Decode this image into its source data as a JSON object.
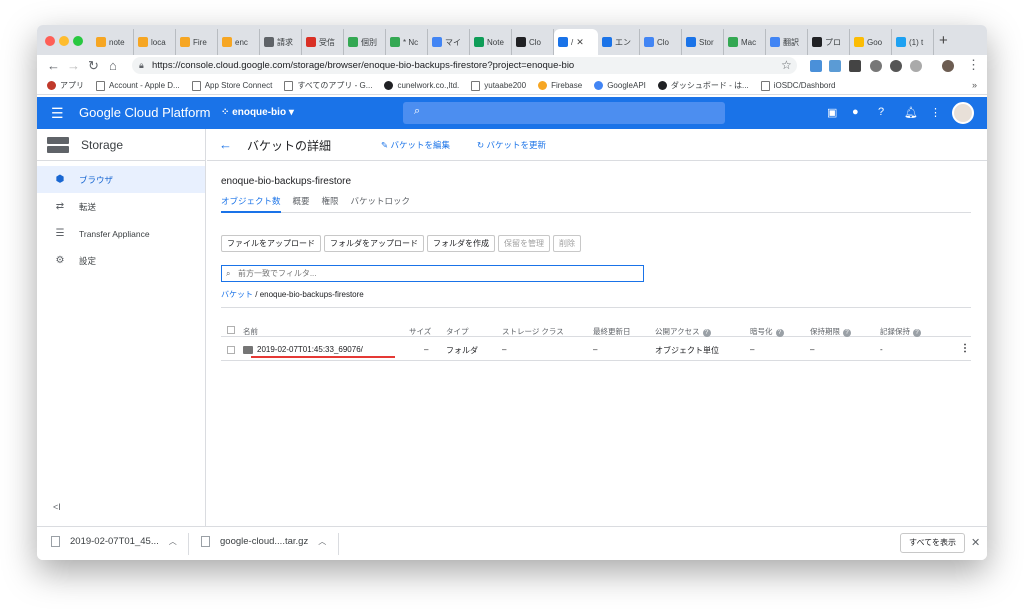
{
  "tabs": [
    {
      "label": "note",
      "color": "#f6a623"
    },
    {
      "label": "loca",
      "color": "#f6a623"
    },
    {
      "label": "Fire",
      "color": "#f6a623"
    },
    {
      "label": "enc",
      "color": "#f6a623"
    },
    {
      "label": "請求",
      "color": "#5f6368"
    },
    {
      "label": "受信",
      "color": "#d93025"
    },
    {
      "label": "個別",
      "color": "#34a853"
    },
    {
      "label": "* Nc",
      "color": "#34a853"
    },
    {
      "label": "マイ",
      "color": "#4285f4"
    },
    {
      "label": "Note",
      "color": "#0f9d58"
    },
    {
      "label": "Clo",
      "color": "#202124"
    },
    {
      "label": "/",
      "color": "#1a73e8",
      "active": true
    },
    {
      "label": "エン",
      "color": "#1a73e8"
    },
    {
      "label": "Clo",
      "color": "#4285f4"
    },
    {
      "label": "Stor",
      "color": "#1a73e8"
    },
    {
      "label": "Mac",
      "color": "#34a853"
    },
    {
      "label": "翻訳",
      "color": "#4285f4"
    },
    {
      "label": "プロ",
      "color": "#202124"
    },
    {
      "label": "Goo",
      "color": "#fbbc04"
    },
    {
      "label": "(1) t",
      "color": "#1da1f2"
    }
  ],
  "address": {
    "url": "https://console.cloud.google.com/storage/browser/enoque-bio-backups-firestore?project=enoque-bio"
  },
  "bookmarks": [
    "アプリ",
    "Account - Apple D...",
    "App Store Connect",
    "すべてのアプリ - G...",
    "cunelwork.co.,ltd.",
    "yutaabe200",
    "Firebase",
    "GoogleAPI",
    "ダッシュボード - は...",
    "iOSDC/Dashbord"
  ],
  "header": {
    "title": "Google Cloud Platform",
    "project": "enoque-bio"
  },
  "sidebar": {
    "title": "Storage",
    "items": [
      {
        "label": "ブラウザ",
        "icon": "bucket-icon"
      },
      {
        "label": "転送",
        "icon": "transfer-icon"
      },
      {
        "label": "Transfer Appliance",
        "icon": "list-icon"
      },
      {
        "label": "設定",
        "icon": "gear-icon"
      }
    ],
    "collapse": "<I"
  },
  "main": {
    "title": "バケットの詳細",
    "edit": "バケットを編集",
    "refresh": "バケットを更新",
    "bucket": "enoque-bio-backups-firestore",
    "tabs": [
      "オブジェクト数",
      "概要",
      "権限",
      "バケットロック"
    ],
    "buttons": [
      "ファイルをアップロード",
      "フォルダをアップロード",
      "フォルダを作成",
      "保留を管理",
      "削除"
    ],
    "filter_placeholder": "前方一致でフィルタ...",
    "breadcrumb": {
      "root": "バケット",
      "current": "enoque-bio-backups-firestore"
    },
    "columns": [
      "名前",
      "サイズ",
      "タイプ",
      "ストレージ クラス",
      "最終更新日",
      "公開アクセス",
      "暗号化",
      "保持期限",
      "記録保持"
    ],
    "row": {
      "name": "2019-02-07T01:45:33_69076/",
      "size": "–",
      "type": "フォルダ",
      "storage": "–",
      "modified": "–",
      "access": "オブジェクト単位",
      "encryption": "–",
      "retention": "–",
      "hold": "-"
    }
  },
  "downloads": {
    "file1": "2019-02-07T01_45...",
    "file2": "google-cloud....tar.gz",
    "show_all": "すべてを表示"
  }
}
